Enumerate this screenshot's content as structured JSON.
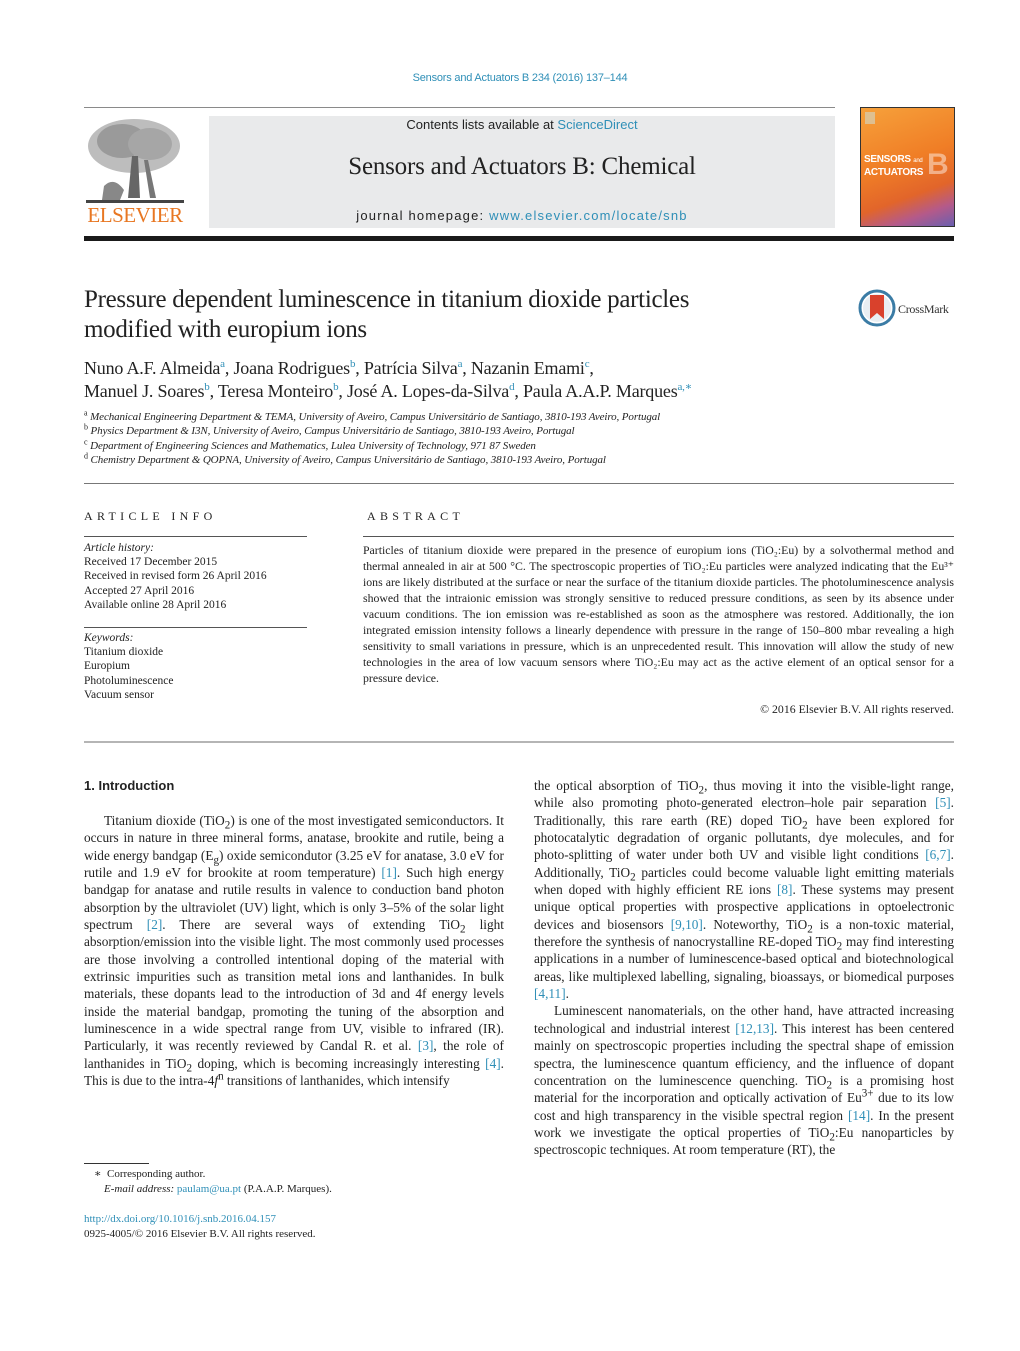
{
  "header": {
    "journal_ref": "Sensors and Actuators B 234 (2016) 137–144",
    "contents_prefix": "Contents lists available at ",
    "contents_link": "ScienceDirect",
    "journal_title": "Sensors and Actuators B: Chemical",
    "homepage_prefix": "journal homepage: ",
    "homepage_link": "www.elsevier.com/locate/snb",
    "publisher_logo_text": "ELSEVIER",
    "cover_line1": "SENSORS",
    "cover_and": "and",
    "cover_line2": "ACTUATORS",
    "cover_letter": "B",
    "crossmark_label": "CrossMark"
  },
  "article": {
    "title_line1": "Pressure dependent luminescence in titanium dioxide particles",
    "title_line2": "modified with europium ions",
    "authors": [
      {
        "name": "Nuno A.F. Almeida",
        "aff": "a",
        "sep": ", "
      },
      {
        "name": "Joana Rodrigues",
        "aff": "b",
        "sep": ", "
      },
      {
        "name": "Patrícia Silva",
        "aff": "a",
        "sep": ", "
      },
      {
        "name": "Nazanin Emami",
        "aff": "c",
        "sep": ","
      },
      {
        "name": "Manuel J. Soares",
        "aff": "b",
        "sep": ", "
      },
      {
        "name": "Teresa Monteiro",
        "aff": "b",
        "sep": ", "
      },
      {
        "name": "José A. Lopes-da-Silva",
        "aff": "d",
        "sep": ", "
      },
      {
        "name": "Paula A.A.P. Marques",
        "aff": "a,∗",
        "sep": ""
      }
    ],
    "affiliations": [
      {
        "key": "a",
        "text": "Mechanical Engineering Department & TEMA, University of Aveiro, Campus Universitário de Santiago, 3810-193 Aveiro, Portugal"
      },
      {
        "key": "b",
        "text": "Physics Department & I3N, University of Aveiro, Campus Universitário de Santiago, 3810-193 Aveiro, Portugal"
      },
      {
        "key": "c",
        "text": "Department of Engineering Sciences and Mathematics, Lulea University of Technology, 971 87 Sweden"
      },
      {
        "key": "d",
        "text": "Chemistry Department & QOPNA, University of Aveiro, Campus Universitário de Santiago, 3810-193 Aveiro, Portugal"
      }
    ]
  },
  "article_info": {
    "heading": "ARTICLE INFO",
    "history_label": "Article history:",
    "history": [
      "Received 17 December 2015",
      "Received in revised form 26 April 2016",
      "Accepted 27 April 2016",
      "Available online 28 April 2016"
    ],
    "keywords_label": "Keywords:",
    "keywords": [
      "Titanium dioxide",
      "Europium",
      "Photoluminescence",
      "Vacuum sensor"
    ]
  },
  "abstract": {
    "heading": "ABSTRACT",
    "text": "Particles of titanium dioxide were prepared in the presence of europium ions (TiO₂:Eu) by a solvothermal method and thermal annealed in air at 500 °C. The spectroscopic properties of TiO₂:Eu particles were analyzed indicating that the Eu³⁺ ions are likely distributed at the surface or near the surface of the titanium dioxide particles. The photoluminescence analysis showed that the intraionic emission was strongly sensitive to reduced pressure conditions, as seen by its absence under vacuum conditions. The ion emission was re-established as soon as the atmosphere was restored. Additionally, the ion integrated emission intensity follows a linearly dependence with pressure in the range of 150–800 mbar revealing a high sensitivity to small variations in pressure, which is an unprecedented result. This innovation will allow the study of new technologies in the area of low vacuum sensors where TiO₂:Eu may act as the active element of an optical sensor for a pressure device.",
    "copyright": "© 2016 Elsevier B.V. All rights reserved."
  },
  "introduction": {
    "heading": "1.  Introduction",
    "paragraphs": [
      [
        {
          "t": "Titanium dioxide (TiO"
        },
        {
          "sub": "2"
        },
        {
          "t": ") is one of the most investigated semiconductors. It occurs in nature in three mineral forms, anatase, brookite and rutile, being a wide energy bandgap (E"
        },
        {
          "sub": "g"
        },
        {
          "t": ") oxide semicondutor (3.25 eV for anatase, 3.0 eV for rutile and 1.9 eV for brookite at room temperature) "
        },
        {
          "ref": "[1]"
        },
        {
          "t": ". Such high energy bandgap for anatase and rutile results in valence to conduction band photon absorption by the ultraviolet (UV) light, which is only 3–5% of the solar light spectrum "
        },
        {
          "ref": "[2]"
        },
        {
          "t": ". There are several ways of extending TiO"
        },
        {
          "sub": "2"
        },
        {
          "t": " light absorption/emission into the visible light. The most commonly used processes are those involving a controlled intentional doping of the material with extrinsic impurities such as transition metal ions and lanthanides. In bulk materials, these dopants lead to the introduction of 3d and 4f energy levels inside the material bandgap, promoting the tuning of the absorption and luminescence in a wide spectral range from UV, visible to infrared (IR). Particularly, it was recently reviewed by Candal R. et al. "
        },
        {
          "ref": "[3]"
        },
        {
          "t": ", the role of lanthanides in TiO"
        },
        {
          "sub": "2"
        },
        {
          "t": " doping, which is becoming increasingly interesting "
        },
        {
          "ref": "[4]"
        },
        {
          "t": ". This is due to the intra-4"
        },
        {
          "i": "f"
        },
        {
          "sup": "n"
        },
        {
          "t": " transitions of lanthanides, which intensify"
        }
      ]
    ],
    "right_paragraphs": [
      [
        {
          "t": "the optical absorption of TiO"
        },
        {
          "sub": "2"
        },
        {
          "t": ", thus moving it into the visible-light range, while also promoting photo-generated electron–hole pair separation "
        },
        {
          "ref": "[5]"
        },
        {
          "t": ". Traditionally, this rare earth (RE) doped TiO"
        },
        {
          "sub": "2"
        },
        {
          "t": " have been explored for photocatalytic degradation of organic pollutants, dye molecules, and for photo-splitting of water under both UV and visible light conditions "
        },
        {
          "ref": "[6,7]"
        },
        {
          "t": ". Additionally, TiO"
        },
        {
          "sub": "2"
        },
        {
          "t": " particles could become valuable light emitting materials when doped with highly efficient RE ions "
        },
        {
          "ref": "[8]"
        },
        {
          "t": ". These systems may present unique optical properties with prospective applications in optoelectronic devices and biosensors "
        },
        {
          "ref": "[9,10]"
        },
        {
          "t": ". Noteworthy, TiO"
        },
        {
          "sub": "2"
        },
        {
          "t": " is a non-toxic material, therefore the synthesis of nanocrystalline RE-doped TiO"
        },
        {
          "sub": "2"
        },
        {
          "t": " may find interesting applications in a number of luminescence-based optical and biotechnological areas, like multiplexed labelling, signaling, bioassays, or biomedical purposes "
        },
        {
          "ref": "[4,11]"
        },
        {
          "t": "."
        }
      ],
      [
        {
          "t": "Luminescent nanomaterials, on the other hand, have attracted increasing technological and industrial interest "
        },
        {
          "ref": "[12,13]"
        },
        {
          "t": ". This interest has been centered mainly on spectroscopic properties including the spectral shape of emission spectra, the luminescence quantum efficiency, and the influence of dopant concentration on the luminescence quenching. TiO"
        },
        {
          "sub": "2"
        },
        {
          "t": " is a promising host material for the incorporation and optically activation of Eu"
        },
        {
          "sup": "3+"
        },
        {
          "t": " due to its low cost and high transparency in the visible spectral region "
        },
        {
          "ref": "[14]"
        },
        {
          "t": ". In the present work we investigate the optical properties of TiO"
        },
        {
          "sub": "2"
        },
        {
          "t": ":Eu nanoparticles by spectroscopic techniques. At room temperature (RT), the"
        }
      ]
    ]
  },
  "footnotes": {
    "corresponding_mark": "∗",
    "corresponding": "Corresponding author.",
    "email_label": "E-mail address:",
    "email": "paulam@ua.pt",
    "email_owner": " (P.A.A.P. Marques).",
    "doi": "http://dx.doi.org/10.1016/j.snb.2016.04.157",
    "issn_copyright": "0925-4005/© 2016 Elsevier B.V. All rights reserved."
  },
  "colors": {
    "link": "#2f8fb7",
    "elsevier_orange": "#e87722"
  }
}
